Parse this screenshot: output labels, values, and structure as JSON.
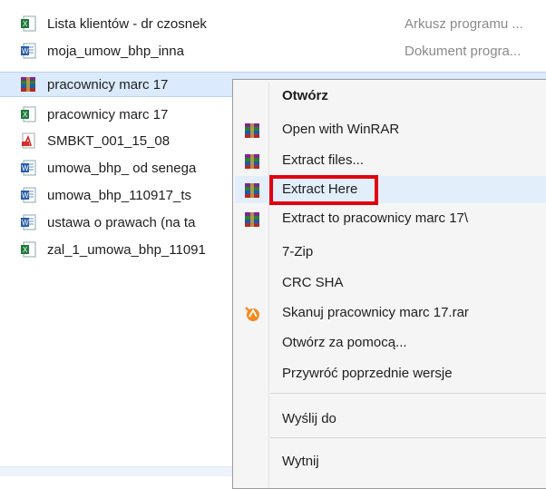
{
  "files": [
    {
      "name": "Lista klientów - dr czosnek",
      "type": "Arkusz programu ...",
      "icon": "excel-icon",
      "selected": false
    },
    {
      "name": "moja_umow_bhp_inna",
      "type": "Dokument progra...",
      "icon": "word-icon",
      "selected": false
    },
    {
      "name": "pracownicy marc 17",
      "type": "",
      "icon": "winrar-icon",
      "selected": true
    },
    {
      "name": "pracownicy marc 17",
      "type": "",
      "icon": "excel-icon",
      "selected": false
    },
    {
      "name": "SMBKT_001_15_08",
      "type": "",
      "icon": "pdf-icon",
      "selected": false
    },
    {
      "name": "umowa_bhp_ od senega",
      "type": "",
      "icon": "word-icon",
      "selected": false
    },
    {
      "name": "umowa_bhp_110917_ts",
      "type": "",
      "icon": "word-icon",
      "selected": false
    },
    {
      "name": "ustawa o prawach (na ta",
      "type": "",
      "icon": "word-icon",
      "selected": false
    },
    {
      "name": "zal_1_umowa_bhp_11091",
      "type": "",
      "icon": "excel-icon",
      "selected": false
    }
  ],
  "context_menu": {
    "items": [
      {
        "label": "Otwórz",
        "icon": "",
        "bold": true
      },
      {
        "label": "Open with WinRAR",
        "icon": "winrar-icon"
      },
      {
        "label": "Extract files...",
        "icon": "winrar-icon"
      },
      {
        "label": "Extract Here",
        "icon": "winrar-icon",
        "hover": true
      },
      {
        "label": "Extract to pracownicy marc 17\\",
        "icon": "winrar-icon"
      },
      {
        "label": "7-Zip",
        "icon": ""
      },
      {
        "label": "CRC SHA",
        "icon": ""
      },
      {
        "label": "Skanuj pracownicy marc 17.rar",
        "icon": "avast-icon"
      },
      {
        "label": "Otwórz za pomocą...",
        "icon": ""
      },
      {
        "label": "Przywróć poprzednie wersje",
        "icon": ""
      },
      {
        "label": "Wyślij do",
        "icon": ""
      },
      {
        "label": "Wytnij",
        "icon": ""
      }
    ]
  },
  "colors": {
    "selection": "#dbeafc",
    "highlight_border": "#e3000f",
    "menu_background": "#f5f5f5"
  }
}
